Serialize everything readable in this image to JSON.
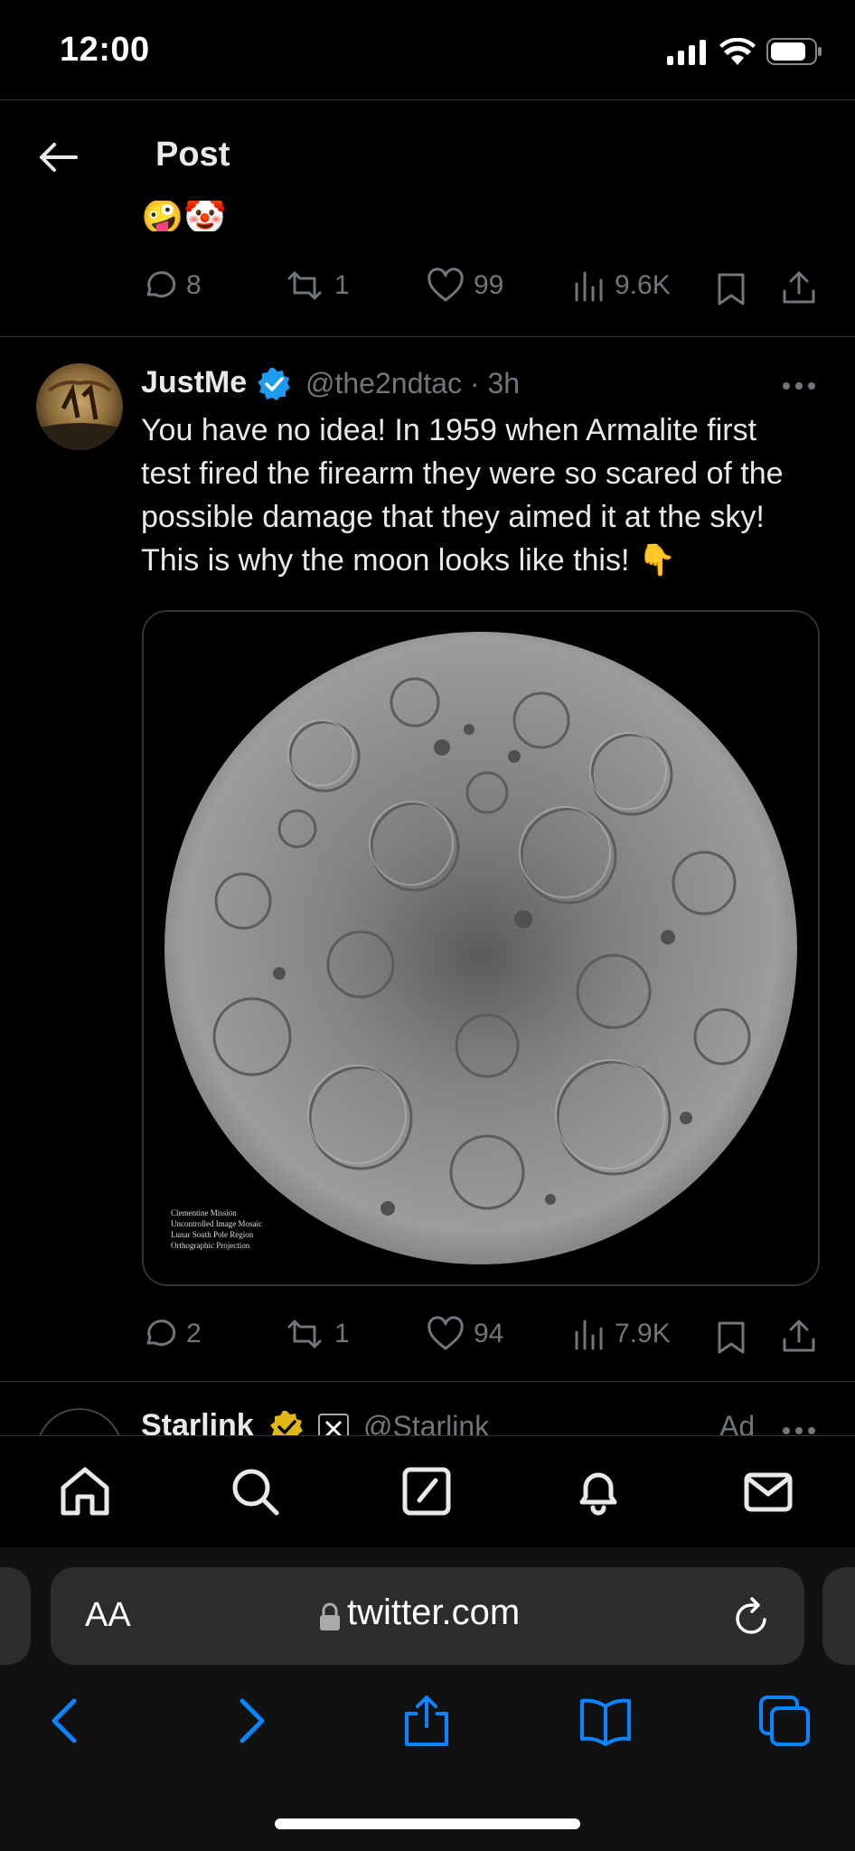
{
  "status_bar": {
    "time": "12:00"
  },
  "header": {
    "title": "Post"
  },
  "prev_tweet": {
    "emoji": "🤪🤡",
    "actions": {
      "replies": "8",
      "retweets": "1",
      "likes": "99",
      "views": "9.6K"
    }
  },
  "tweet": {
    "author_name": "JustMe",
    "handle_time": "@the2ndtac · 3h",
    "text": "You have no idea! In 1959 when Armalite first test fired the firearm they were so scared of the possible damage that they aimed it at the sky! This is why the moon looks like this! 👇",
    "media_caption_lines": [
      "Clementine Mission",
      "Uncontrolled Image Mosaic",
      "Lunar South Pole Region",
      "Orthographic Projection"
    ],
    "actions": {
      "replies": "2",
      "retweets": "1",
      "likes": "94",
      "views": "7.9K"
    }
  },
  "next_tweet": {
    "author_name": "Starlink",
    "handle": "@Starlink",
    "ad_label": "Ad"
  },
  "browser": {
    "aa_label": "AA",
    "url": "twitter.com"
  },
  "colors": {
    "background": "#000000",
    "text": "#e7e9ea",
    "muted": "#71767b",
    "verified": "#1d9bf0",
    "safari_blue": "#0a84ff",
    "gold": "#e2b719"
  },
  "icons": [
    "back-arrow-icon",
    "reply-icon",
    "retweet-icon",
    "like-icon",
    "views-icon",
    "bookmark-icon",
    "share-icon",
    "verified-badge-icon",
    "more-icon",
    "home-icon",
    "search-icon",
    "compose-icon",
    "notifications-icon",
    "messages-icon",
    "lock-icon",
    "reload-icon",
    "safari-back-icon",
    "safari-forward-icon",
    "safari-share-icon",
    "bookmarks-icon",
    "tabs-icon"
  ]
}
